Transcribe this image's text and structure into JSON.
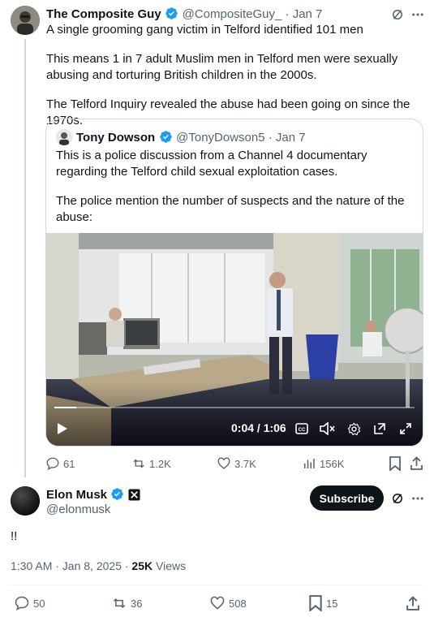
{
  "tweet": {
    "author_name": "The Composite Guy",
    "handle_date": "@CompositeGuy_ · Jan 7",
    "paragraphs": [
      "A single grooming gang victim in Telford identified 101 men",
      "This means 1 in 7 adult Muslim men in Telford men were sexually abusing and torturing British children in the 2000s.",
      "The Telford Inquiry revealed the abuse had been going on since the 1970s."
    ],
    "quote": {
      "author_name": "Tony Dowson",
      "handle_date": "@TonyDowson5 · Jan 7",
      "paragraphs": [
        "This is a police discussion from a Channel 4 documentary regarding the Telford child sexual exploitation cases.",
        "The police mention the number of suspects and the nature of the abuse:"
      ],
      "video": {
        "time": "0:04 / 1:06",
        "progress": 0.06
      }
    },
    "stats": {
      "replies": "61",
      "reposts": "1.2K",
      "likes": "3.7K",
      "views": "156K"
    }
  },
  "reply": {
    "author_name": "Elon Musk",
    "handle": "@elonmusk",
    "subscribe_label": "Subscribe",
    "text": "!!",
    "timestamp": "1:30 AM · Jan 8, 2025 · ",
    "views_count": "25K",
    "views_label": " Views",
    "stats": {
      "replies": "50",
      "reposts": "36",
      "likes": "508",
      "bookmarks": "15"
    }
  },
  "colors": {
    "accent": "#1d9bf0",
    "text": "#0f1419",
    "muted": "#536471",
    "border": "#cfd9de"
  }
}
